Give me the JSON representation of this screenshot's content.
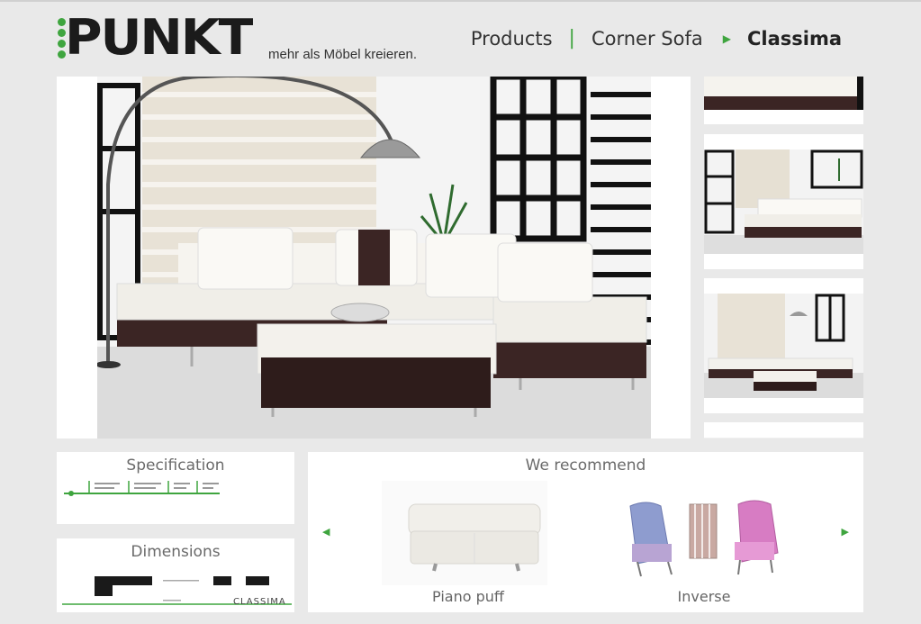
{
  "header": {
    "logo_text": "PUNKT",
    "tagline": "mehr als Möbel kreieren.",
    "breadcrumb": {
      "items": [
        "Products",
        "Corner Sofa"
      ],
      "current": "Classima"
    }
  },
  "hero": {
    "icon": "corner-sofa-photo"
  },
  "thumbnails": [
    {
      "icon": "sofa-detail-thumbnail"
    },
    {
      "icon": "sofa-room-thumbnail"
    },
    {
      "icon": "sofa-living-room-thumbnail"
    },
    {
      "icon": "sofa-partial-thumbnail"
    }
  ],
  "specification": {
    "title": "Specification"
  },
  "dimensions": {
    "title": "Dimensions",
    "drawing_label": "CLASSIMA"
  },
  "recommend": {
    "title": "We recommend",
    "items": [
      {
        "label": "Piano puff"
      },
      {
        "label": "Inverse"
      }
    ]
  },
  "colors": {
    "accent": "#3fa53f",
    "background": "#e9e9e9",
    "dark_leather": "#3b2524"
  }
}
